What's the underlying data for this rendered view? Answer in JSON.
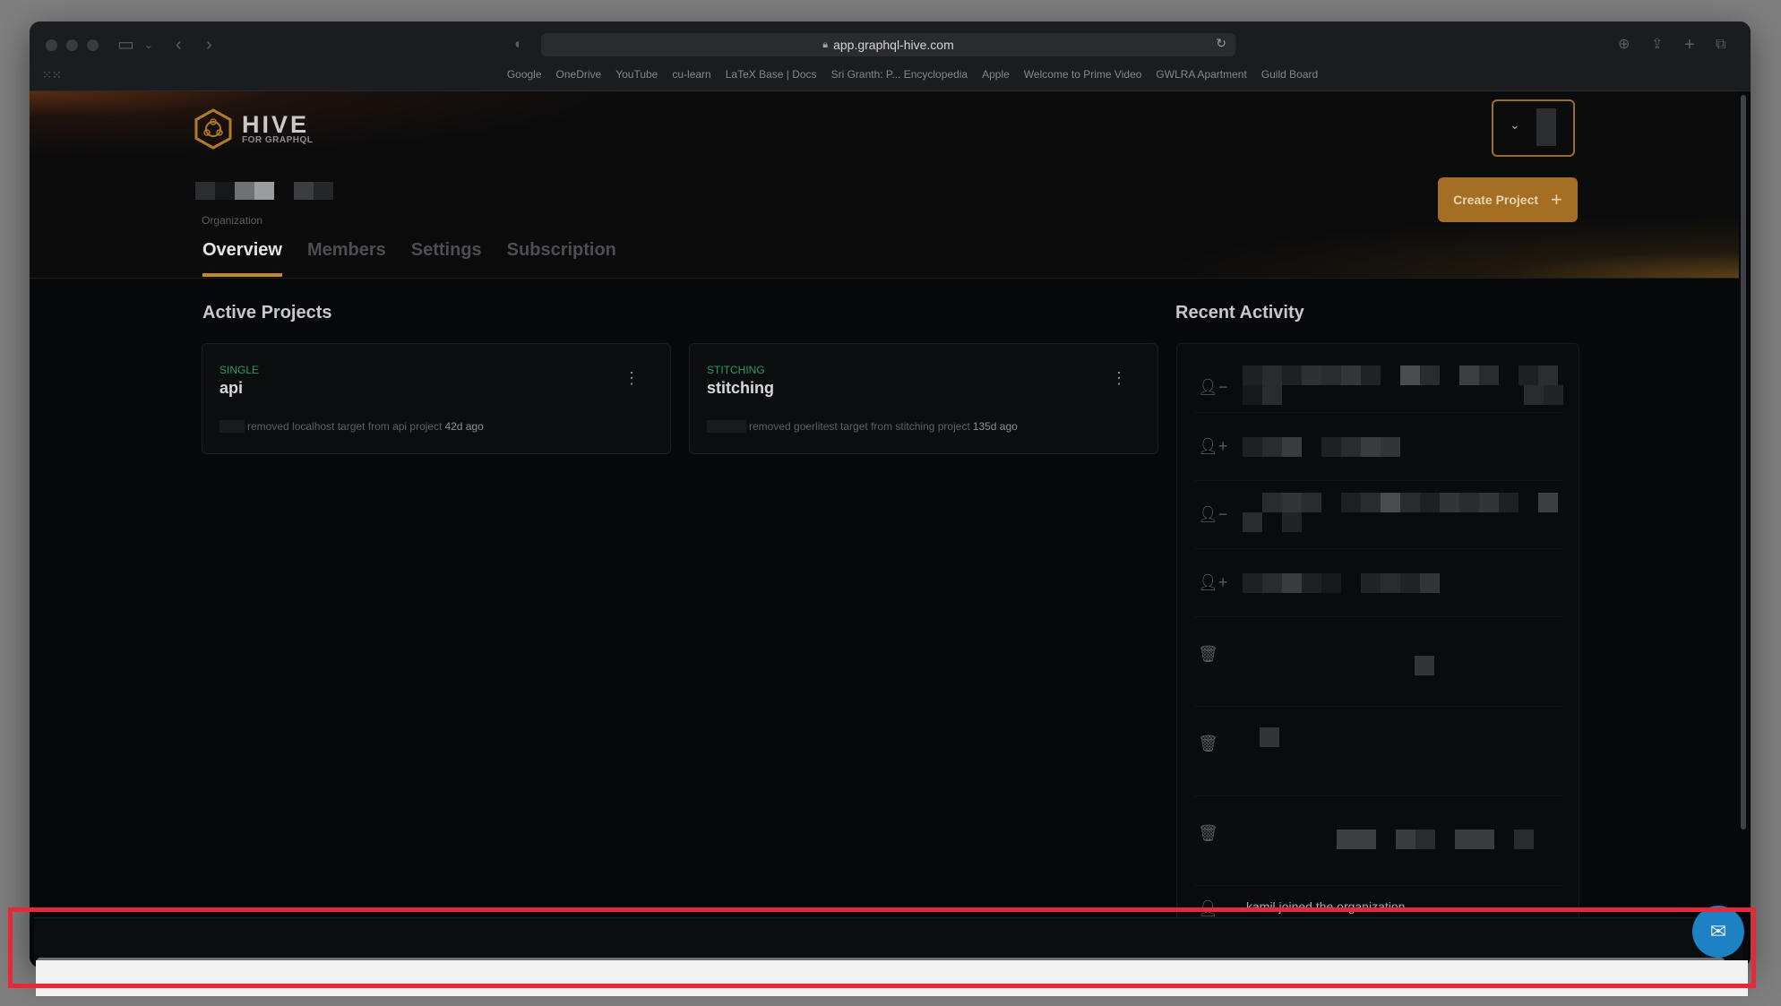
{
  "browser": {
    "url": "app.graphql-hive.com",
    "bookmarks": [
      "Google",
      "OneDrive",
      "YouTube",
      "cu-learn",
      "LaTeX Base | Docs",
      "Sri Granth: P... Encyclopedia",
      "Apple",
      "Welcome to Prime Video",
      "GWLRA Apartment",
      "Guild Board"
    ]
  },
  "header": {
    "logo_title": "HIVE",
    "logo_subtitle": "FOR GRAPHQL",
    "org_label": "Organization",
    "tabs": [
      "Overview",
      "Members",
      "Settings",
      "Subscription"
    ],
    "active_tab": "Overview",
    "create_button": "Create Project",
    "accent_color": "#c48a2a"
  },
  "projects": {
    "title": "Active Projects",
    "items": [
      {
        "type": "SINGLE",
        "name": "api",
        "activity": "removed localhost target from api project",
        "ago": "42d ago"
      },
      {
        "type": "STITCHING",
        "name": "stitching",
        "activity": "removed goerlitest target from stitching project",
        "ago": "135d ago"
      }
    ]
  },
  "activity": {
    "title": "Recent Activity",
    "rows": [
      {
        "icon": "user-minus-icon"
      },
      {
        "icon": "user-plus-icon"
      },
      {
        "icon": "user-minus-icon"
      },
      {
        "icon": "user-plus-icon"
      },
      {
        "icon": "trash-icon"
      },
      {
        "icon": "trash-icon"
      },
      {
        "icon": "trash-icon"
      }
    ],
    "last_row_text": "kamil joined the organization",
    "last_row_ago": "..."
  }
}
